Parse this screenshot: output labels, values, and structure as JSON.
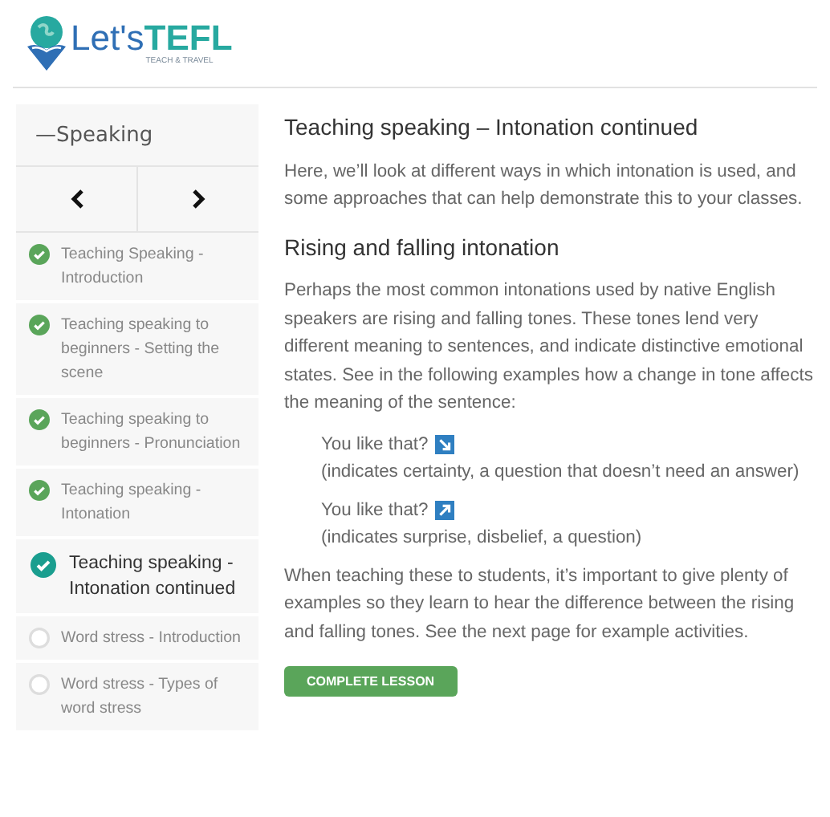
{
  "logo": {
    "brand_light": "Let's",
    "brand_bold": "TEFL",
    "tagline": "TEACH & TRAVEL"
  },
  "sidebar": {
    "title": "—Speaking",
    "nav": [
      {
        "kind": "prev"
      },
      {
        "kind": "next"
      }
    ],
    "items": [
      {
        "label": "Teaching Speaking - Introduction",
        "completed": true,
        "selected": false
      },
      {
        "label": "Teaching speaking to beginners - Setting the scene",
        "completed": true,
        "selected": false
      },
      {
        "label": "Teaching speaking to beginners - Pronunciation",
        "completed": true,
        "selected": false
      },
      {
        "label": "Teaching speaking - Intonation",
        "completed": true,
        "selected": false
      },
      {
        "label": "Teaching speaking - Intonation continued",
        "completed": true,
        "selected": true
      },
      {
        "label": "Word stress - Introduction",
        "completed": false,
        "selected": false
      },
      {
        "label": "Word stress - Types of word stress",
        "completed": false,
        "selected": false
      }
    ]
  },
  "content": {
    "title": "Teaching speaking – Intonation continued",
    "intro": "Here, we’ll look at different ways in which intonation is used, and some approaches that can help demonstrate this to your classes.",
    "subheading": "Rising and falling intonation",
    "paragraph": "Perhaps the most common intonations used by native English speakers are rising and falling tones. These tones lend very different meaning to sentences, and indicate distinctive emotional states. See in the following examples how a change in tone affects the meaning of the sentence:",
    "examples": [
      {
        "sentence": "You like that?",
        "kind": "falling",
        "note": "(indicates certainty, a question that doesn’t need an answer)"
      },
      {
        "sentence": "You like that?",
        "kind": "rising",
        "note": "(indicates surprise, disbelief, a question)"
      }
    ],
    "closing": "When teaching these to students, it’s important to give plenty of examples so they learn to hear the difference between the rising and falling tones. See the next page for example activities.",
    "button": "COMPLETE LESSON"
  }
}
